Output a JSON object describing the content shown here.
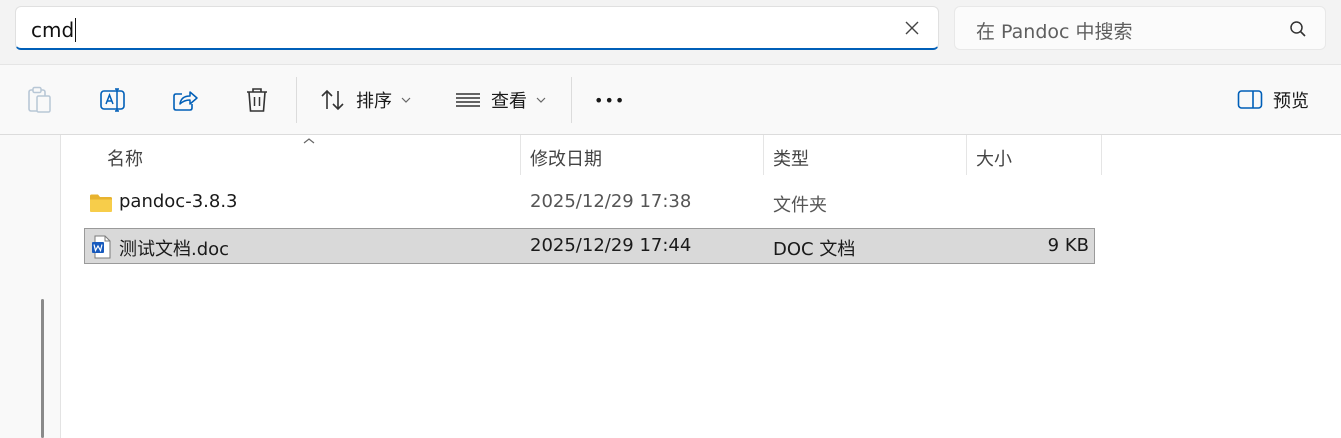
{
  "address_bar": {
    "value": "cmd"
  },
  "search": {
    "placeholder": "在 Pandoc 中搜索"
  },
  "toolbar": {
    "sort_label": "排序",
    "view_label": "查看",
    "more_label": "•••",
    "preview_label": "预览"
  },
  "columns": {
    "name": "名称",
    "date": "修改日期",
    "type": "类型",
    "size": "大小"
  },
  "files": [
    {
      "name": "pandoc-3.8.3",
      "date": "2025/12/29 17:38",
      "type": "文件夹",
      "size": "",
      "icon": "folder-icon"
    },
    {
      "name": "测试文档.doc",
      "date": "2025/12/29 17:44",
      "type": "DOC 文档",
      "size": "9 KB",
      "icon": "word-document-icon"
    }
  ],
  "colors": {
    "accent": "#005fb8",
    "folder": "#f5c33b",
    "word": "#185abd",
    "selection": "#d9d9d9"
  }
}
